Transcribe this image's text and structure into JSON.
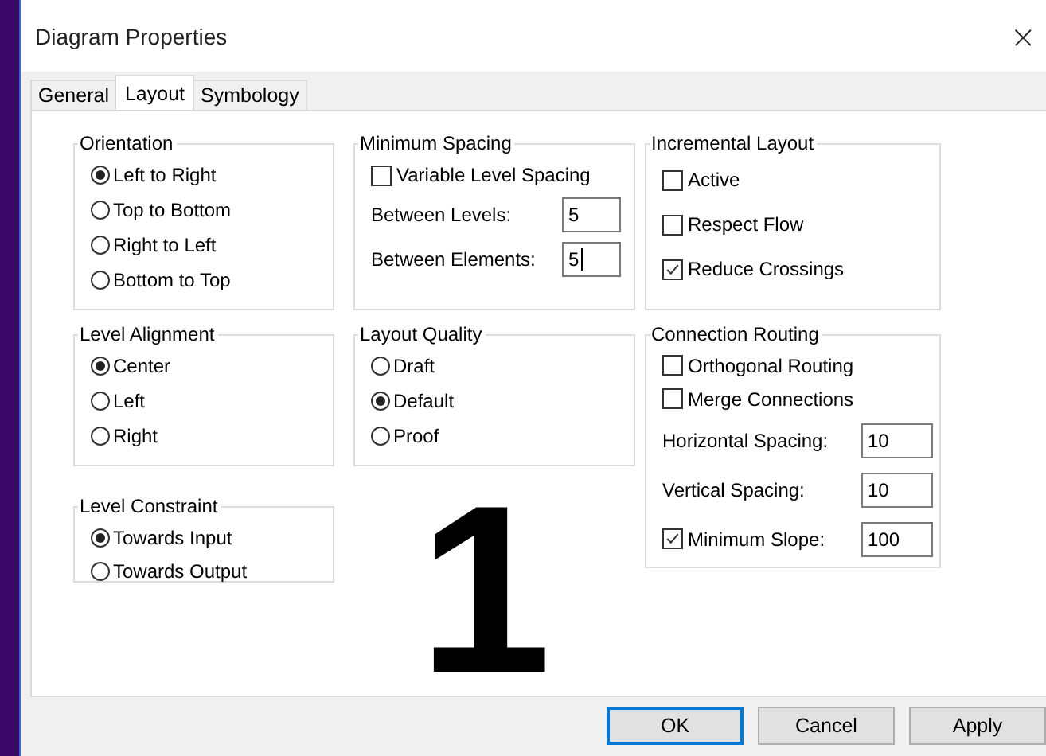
{
  "window": {
    "title": "Diagram Properties",
    "close": "×"
  },
  "tabs": [
    {
      "label": "General",
      "selected": false
    },
    {
      "label": "Layout",
      "selected": true
    },
    {
      "label": "Symbology",
      "selected": false
    }
  ],
  "columns": [
    {
      "groups": [
        {
          "title": "Orientation",
          "items": [
            {
              "kind": "radio",
              "label": "Left to Right",
              "selected": true
            },
            {
              "kind": "radio",
              "label": "Top to Bottom",
              "selected": false
            },
            {
              "kind": "radio",
              "label": "Right to Left",
              "selected": false
            },
            {
              "kind": "radio",
              "label": "Bottom to Top",
              "selected": false
            }
          ]
        },
        {
          "title": "Level Alignment",
          "items": [
            {
              "kind": "radio",
              "label": "Center",
              "selected": true
            },
            {
              "kind": "radio",
              "label": "Left",
              "selected": false
            },
            {
              "kind": "radio",
              "label": "Right",
              "selected": false
            }
          ]
        },
        {
          "title": "Level Constraint",
          "items": [
            {
              "kind": "radio",
              "label": "Towards Input",
              "selected": true
            },
            {
              "kind": "radio",
              "label": "Towards Output",
              "selected": false
            }
          ]
        }
      ]
    },
    {
      "groups": [
        {
          "title": "Minimum Spacing",
          "items": [
            {
              "kind": "checkbox",
              "label": "Variable Level Spacing",
              "checked": false
            },
            {
              "kind": "number",
              "label": "Between Levels:",
              "value": "5",
              "focused": false
            },
            {
              "kind": "number",
              "label": "Between Elements:",
              "value": "5",
              "focused": true
            }
          ]
        },
        {
          "title": "Layout Quality",
          "items": [
            {
              "kind": "radio",
              "label": "Draft",
              "selected": false
            },
            {
              "kind": "radio",
              "label": "Default",
              "selected": true
            },
            {
              "kind": "radio",
              "label": "Proof",
              "selected": false
            }
          ]
        }
      ]
    },
    {
      "groups": [
        {
          "title": "Incremental Layout",
          "items": [
            {
              "kind": "checkbox",
              "label": "Active",
              "checked": false
            },
            {
              "kind": "checkbox",
              "label": "Respect Flow",
              "checked": false
            },
            {
              "kind": "checkbox",
              "label": "Reduce Crossings",
              "checked": true
            }
          ]
        },
        {
          "title": "Connection Routing",
          "items": [
            {
              "kind": "checkbox",
              "label": "Orthogonal Routing",
              "checked": false
            },
            {
              "kind": "checkbox",
              "label": "Merge Connections",
              "checked": false
            },
            {
              "kind": "number",
              "label": "Horizontal Spacing:",
              "value": "10",
              "focused": false
            },
            {
              "kind": "number",
              "label": "Vertical Spacing:",
              "value": "10",
              "focused": false
            },
            {
              "kind": "checknumber",
              "label": "Minimum Slope:",
              "checked": true,
              "value": "100"
            }
          ]
        }
      ]
    }
  ],
  "overlay_number": "1",
  "buttons": [
    {
      "label": "OK",
      "default": true
    },
    {
      "label": "Cancel",
      "default": false
    },
    {
      "label": "Apply",
      "default": false
    }
  ]
}
